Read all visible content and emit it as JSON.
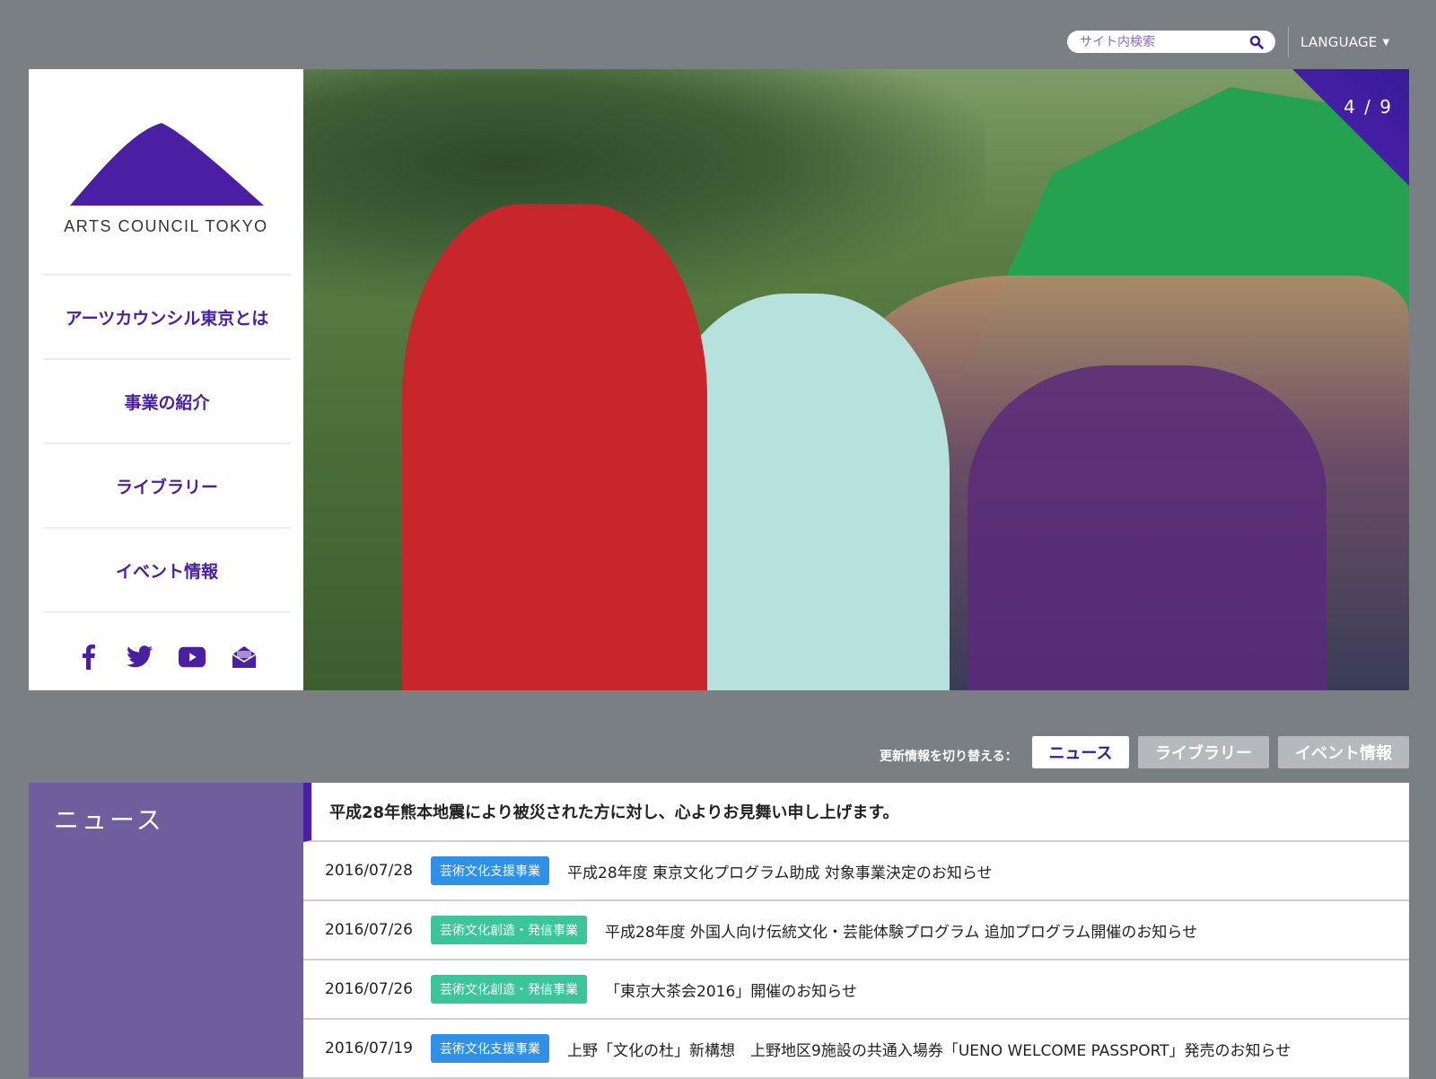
{
  "header": {
    "search_placeholder": "サイト内検索",
    "language_label": "LANGUAGE",
    "language_caret": "▼"
  },
  "brand": {
    "name": "ARTS COUNCIL TOKYO",
    "color": "#4a1fa3"
  },
  "sidebar": {
    "items": [
      {
        "label": "アーツカウンシル東京とは"
      },
      {
        "label": "事業の紹介"
      },
      {
        "label": "ライブラリー"
      },
      {
        "label": "イベント情報"
      }
    ],
    "social_icons": [
      "facebook-icon",
      "twitter-icon",
      "youtube-icon",
      "mail-icon"
    ]
  },
  "hero": {
    "counter": "4 / 9"
  },
  "switcher": {
    "label": "更新情報を切り替える：",
    "tabs": [
      {
        "label": "ニュース",
        "active": true
      },
      {
        "label": "ライブラリー",
        "active": false
      },
      {
        "label": "イベント情報",
        "active": false
      }
    ]
  },
  "news": {
    "title": "ニュース",
    "notice": "平成28年熊本地震により被災された方に対し、心よりお見舞い申し上げます。",
    "rows": [
      {
        "date": "2016/07/28",
        "category": "芸術文化支援事業",
        "category_color": "#2f90e8",
        "text": "平成28年度 東京文化プログラム助成 対象事業決定のお知らせ"
      },
      {
        "date": "2016/07/26",
        "category": "芸術文化創造・発信事業",
        "category_color": "#3dc59a",
        "text": "平成28年度 外国人向け伝統文化・芸能体験プログラム 追加プログラム開催のお知らせ"
      },
      {
        "date": "2016/07/26",
        "category": "芸術文化創造・発信事業",
        "category_color": "#3dc59a",
        "text": "「東京大茶会2016」開催のお知らせ"
      },
      {
        "date": "2016/07/19",
        "category": "芸術文化支援事業",
        "category_color": "#2f90e8",
        "text": "上野「文化の杜」新構想　上野地区9施設の共通入場券「UENO WELCOME PASSPORT」発売のお知らせ"
      }
    ]
  }
}
